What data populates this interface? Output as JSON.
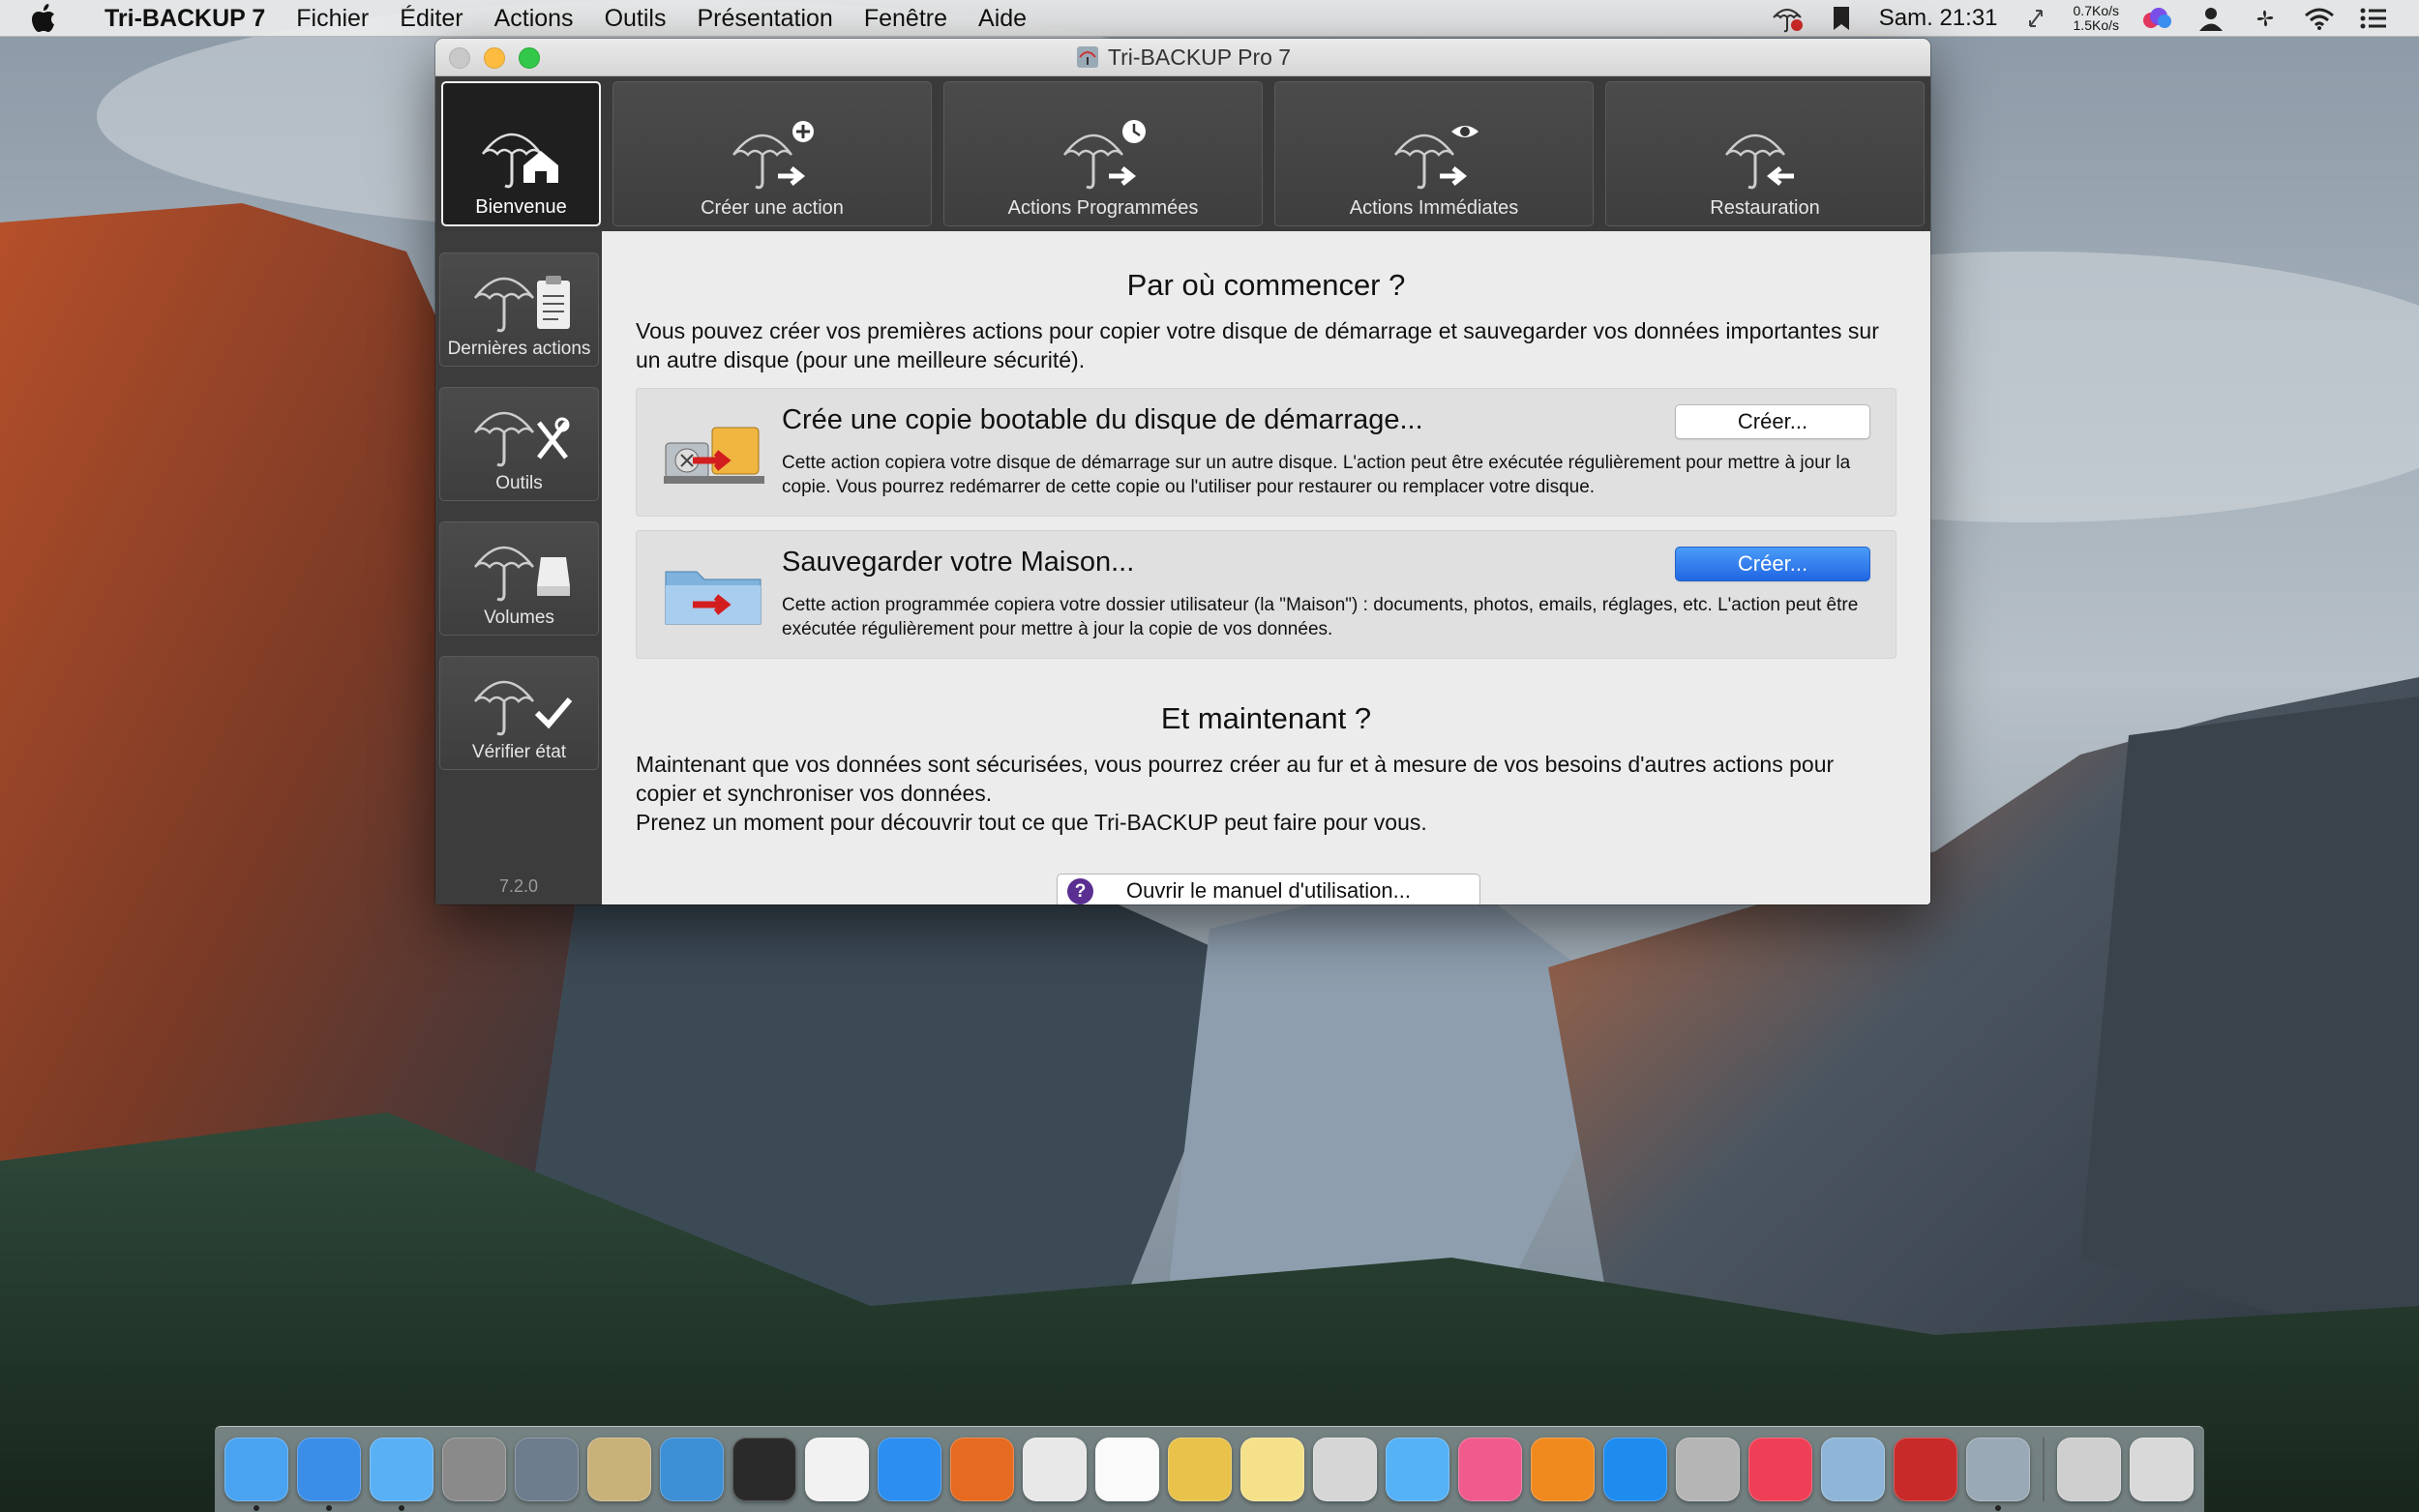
{
  "menubar": {
    "app_name": "Tri-BACKUP 7",
    "items": [
      "Fichier",
      "Éditer",
      "Actions",
      "Outils",
      "Présentation",
      "Fenêtre",
      "Aide"
    ],
    "clock": "Sam. 21:31",
    "net_up": "0.7Ko/s",
    "net_down": "1.5Ko/s"
  },
  "window": {
    "title": "Tri-BACKUP Pro 7",
    "toolbar": [
      {
        "label": "Bienvenue",
        "icon": "umbrella-home-icon"
      },
      {
        "label": "Créer une action",
        "icon": "umbrella-plus-icon"
      },
      {
        "label": "Actions Programmées",
        "icon": "umbrella-clock-icon"
      },
      {
        "label": "Actions Immédiates",
        "icon": "umbrella-eye-icon"
      },
      {
        "label": "Restauration",
        "icon": "umbrella-restore-icon"
      }
    ],
    "sidebar": [
      {
        "label": "Dernières actions",
        "icon": "umbrella-clipboard-icon"
      },
      {
        "label": "Outils",
        "icon": "umbrella-tools-icon"
      },
      {
        "label": "Volumes",
        "icon": "umbrella-volume-icon"
      },
      {
        "label": "Vérifier état",
        "icon": "umbrella-check-icon"
      }
    ],
    "version": "7.2.0"
  },
  "content": {
    "heading1": "Par où commencer ?",
    "intro": "Vous pouvez créer vos premières actions pour copier votre disque de démarrage et sauvegarder vos données importantes sur un autre disque (pour une meilleure sécurité).",
    "cards": [
      {
        "title": "Crée une copie bootable du disque de démarrage...",
        "description": "Cette action copiera votre disque de démarrage sur un autre disque. L'action peut être exécutée régulièrement pour mettre à jour la copie. Vous pourrez redémarrer de cette copie ou l'utiliser pour restaurer ou remplacer votre disque.",
        "button": "Créer..."
      },
      {
        "title": "Sauvegarder votre Maison...",
        "description": "Cette action programmée copiera votre dossier utilisateur (la \"Maison\") : documents, photos, emails, réglages, etc. L'action peut être exécutée régulièrement pour mettre à jour la copie de vos données.",
        "button": "Créer..."
      }
    ],
    "heading2": "Et maintenant ?",
    "outro1": "Maintenant que vos données sont sécurisées, vous pourrez créer au fur et à mesure de vos besoins d'autres actions pour copier et synchroniser vos données.",
    "outro2": "Prenez un moment pour découvrir tout ce que Tri-BACKUP peut faire pour vous.",
    "manual_button": "Ouvrir le manuel d'utilisation..."
  },
  "dock": {
    "apps": [
      {
        "name": "finder-icon",
        "color": "#4aa3f0",
        "running": true
      },
      {
        "name": "bookmark-app-icon",
        "color": "#3b8ee8",
        "running": true
      },
      {
        "name": "tweetbot-icon",
        "color": "#5ab0f5",
        "running": true
      },
      {
        "name": "system-preferences-icon",
        "color": "#8a8a8a",
        "running": false
      },
      {
        "name": "launchpad-icon",
        "color": "#6d7d8d",
        "running": false
      },
      {
        "name": "mail-stamp-icon",
        "color": "#c9b27a",
        "running": false
      },
      {
        "name": "1password-icon",
        "color": "#3d8fd6",
        "running": false
      },
      {
        "name": "camera-icon",
        "color": "#2a2a2a",
        "running": false
      },
      {
        "name": "photos-icon",
        "color": "#f2f2f2",
        "running": false
      },
      {
        "name": "safari-icon",
        "color": "#2b8ef0",
        "running": false
      },
      {
        "name": "firefox-icon",
        "color": "#e66a1f",
        "running": false
      },
      {
        "name": "chrome-icon",
        "color": "#e8e8e8",
        "running": false
      },
      {
        "name": "ia-writer-icon",
        "color": "#fafafa",
        "running": false
      },
      {
        "name": "flask-app-icon",
        "color": "#e8c24a",
        "running": false
      },
      {
        "name": "notes-icon",
        "color": "#f5e18a",
        "running": false
      },
      {
        "name": "preview-icon",
        "color": "#d6d6d6",
        "running": false
      },
      {
        "name": "messages-icon",
        "color": "#56b2f7",
        "running": false
      },
      {
        "name": "itunes-icon",
        "color": "#f05a8c",
        "running": false
      },
      {
        "name": "ibooks-icon",
        "color": "#f08a1f",
        "running": false
      },
      {
        "name": "app-store-icon",
        "color": "#1e8bef",
        "running": false
      },
      {
        "name": "scripting-icon",
        "color": "#b5b5b5",
        "running": false
      },
      {
        "name": "pocket-icon",
        "color": "#ef3f56",
        "running": false
      },
      {
        "name": "image-capture-icon",
        "color": "#8fb6d8",
        "running": false
      },
      {
        "name": "pro-app-icon",
        "color": "#c82a2a",
        "running": false
      },
      {
        "name": "tri-backup-icon",
        "color": "#9aa9b6",
        "running": true
      }
    ],
    "trailing": [
      {
        "name": "downloads-stack-icon",
        "color": "#cfcfcf"
      },
      {
        "name": "trash-icon",
        "color": "#d9d9d9"
      }
    ]
  }
}
